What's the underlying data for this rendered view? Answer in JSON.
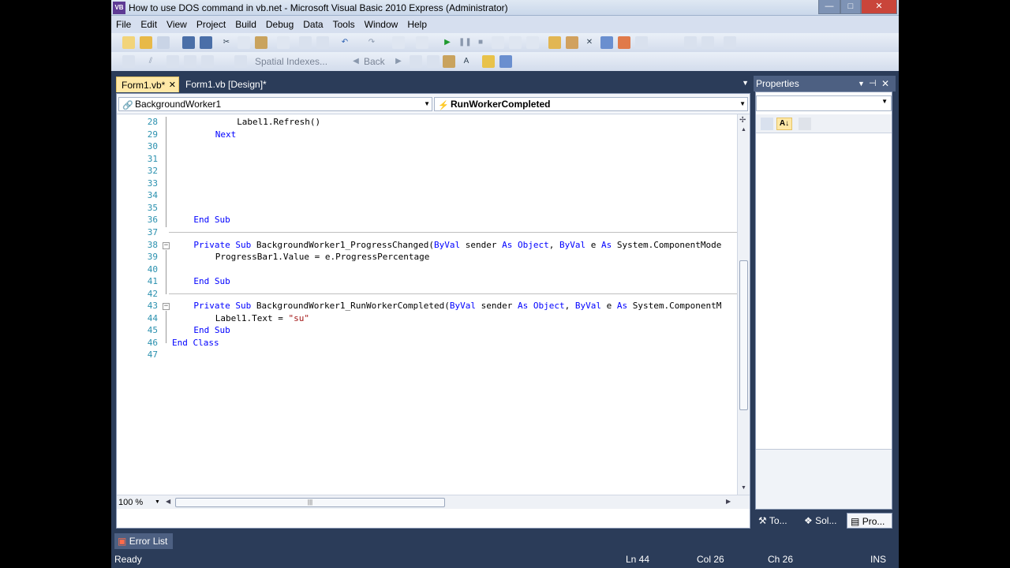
{
  "window": {
    "title": "How to use DOS command in vb.net - Microsoft Visual Basic 2010 Express (Administrator)",
    "app_icon": "VB",
    "controls": {
      "minimize": "—",
      "maximize": "□",
      "close": "✕"
    }
  },
  "menu": [
    "File",
    "Edit",
    "View",
    "Project",
    "Build",
    "Debug",
    "Data",
    "Tools",
    "Window",
    "Help"
  ],
  "toolbar2": {
    "spatial_indexes": "Spatial Indexes...",
    "back": "Back"
  },
  "tabs": [
    {
      "label": "Form1.vb*",
      "close": "✕"
    },
    {
      "label": "Form1.vb [Design]*"
    }
  ],
  "editor": {
    "object_combo": "BackgroundWorker1",
    "event_combo": "RunWorkerCompleted",
    "zoom": "100 %",
    "lines": [
      {
        "n": "28",
        "indent": 3,
        "parts": [
          {
            "t": "Label1.Refresh()",
            "c": ""
          }
        ]
      },
      {
        "n": "29",
        "indent": 2,
        "parts": [
          {
            "t": "Next",
            "c": "kw"
          }
        ]
      },
      {
        "n": "30",
        "indent": 0,
        "parts": []
      },
      {
        "n": "31",
        "indent": 0,
        "parts": []
      },
      {
        "n": "32",
        "indent": 0,
        "parts": []
      },
      {
        "n": "33",
        "indent": 0,
        "parts": []
      },
      {
        "n": "34",
        "indent": 0,
        "parts": []
      },
      {
        "n": "35",
        "indent": 0,
        "parts": []
      },
      {
        "n": "36",
        "indent": 1,
        "parts": [
          {
            "t": "End Sub",
            "c": "kw"
          }
        ]
      },
      {
        "n": "37",
        "indent": 0,
        "parts": []
      },
      {
        "n": "38",
        "indent": 1,
        "fold": true,
        "parts": [
          {
            "t": "Private Sub ",
            "c": "kw"
          },
          {
            "t": "BackgroundWorker1_ProgressChanged(",
            "c": ""
          },
          {
            "t": "ByVal",
            "c": "kw"
          },
          {
            "t": " sender ",
            "c": ""
          },
          {
            "t": "As Object",
            "c": "kw"
          },
          {
            "t": ", ",
            "c": ""
          },
          {
            "t": "ByVal",
            "c": "kw"
          },
          {
            "t": " e ",
            "c": ""
          },
          {
            "t": "As",
            "c": "kw"
          },
          {
            "t": " System.ComponentMode",
            "c": ""
          }
        ]
      },
      {
        "n": "39",
        "indent": 2,
        "parts": [
          {
            "t": "ProgressBar1.Value = e.ProgressPercentage",
            "c": ""
          }
        ]
      },
      {
        "n": "40",
        "indent": 0,
        "parts": []
      },
      {
        "n": "41",
        "indent": 1,
        "parts": [
          {
            "t": "End Sub",
            "c": "kw"
          }
        ]
      },
      {
        "n": "42",
        "indent": 0,
        "parts": []
      },
      {
        "n": "43",
        "indent": 1,
        "fold": true,
        "parts": [
          {
            "t": "Private Sub ",
            "c": "kw"
          },
          {
            "t": "BackgroundWorker1_RunWorkerCompleted(",
            "c": ""
          },
          {
            "t": "ByVal",
            "c": "kw"
          },
          {
            "t": " sender ",
            "c": ""
          },
          {
            "t": "As Object",
            "c": "kw"
          },
          {
            "t": ", ",
            "c": ""
          },
          {
            "t": "ByVal",
            "c": "kw"
          },
          {
            "t": " e ",
            "c": ""
          },
          {
            "t": "As",
            "c": "kw"
          },
          {
            "t": " System.ComponentM",
            "c": ""
          }
        ]
      },
      {
        "n": "44",
        "indent": 2,
        "parts": [
          {
            "t": "Label1.Text = ",
            "c": ""
          },
          {
            "t": "\"su\"",
            "c": "str"
          }
        ]
      },
      {
        "n": "45",
        "indent": 1,
        "parts": [
          {
            "t": "End Sub",
            "c": "kw"
          }
        ]
      },
      {
        "n": "46",
        "indent": 0,
        "parts": [
          {
            "t": "End Class",
            "c": "kw"
          }
        ]
      },
      {
        "n": "47",
        "indent": 0,
        "parts": []
      }
    ]
  },
  "properties": {
    "title": "Properties",
    "tabs": [
      "To...",
      "Sol...",
      "Pro..."
    ]
  },
  "error_list": "Error List",
  "status": {
    "state": "Ready",
    "ln": "Ln 44",
    "col": "Col 26",
    "ch": "Ch 26",
    "mode": "INS"
  }
}
